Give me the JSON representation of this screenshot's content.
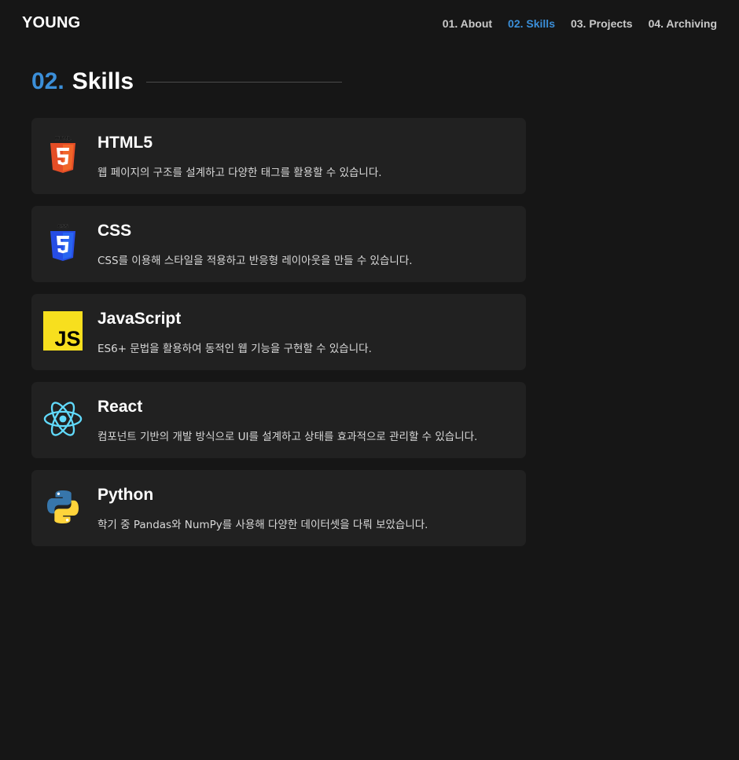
{
  "header": {
    "logo": "YOUNG",
    "nav": [
      {
        "label": "01. About",
        "active": false
      },
      {
        "label": "02. Skills",
        "active": true
      },
      {
        "label": "03. Projects",
        "active": false
      },
      {
        "label": "04. Archiving",
        "active": false
      }
    ]
  },
  "section": {
    "number": "02.",
    "title": "Skills"
  },
  "skills": [
    {
      "icon": "html5-icon",
      "name": "HTML5",
      "description": "웹 페이지의 구조를 설계하고 다양한 태그를 활용할 수 있습니다."
    },
    {
      "icon": "css3-icon",
      "name": "CSS",
      "description": "CSS를 이용해 스타일을 적용하고 반응형 레이아웃을 만들 수 있습니다."
    },
    {
      "icon": "javascript-icon",
      "name": "JavaScript",
      "description": "ES6+ 문법을 활용하여 동적인 웹 기능을 구현할 수 있습니다."
    },
    {
      "icon": "react-icon",
      "name": "React",
      "description": "컴포넌트 기반의 개발 방식으로 UI를 설계하고 상태를 효과적으로 관리할 수 있습니다."
    },
    {
      "icon": "python-icon",
      "name": "Python",
      "description": "학기 중 Pandas와 NumPy를 사용해 다양한 데이터셋을 다뤄 보았습니다."
    }
  ],
  "colors": {
    "background": "#161616",
    "card": "#212121",
    "accent": "#3b8fd9",
    "html5": "#e44d26",
    "css3": "#264de4",
    "javascript": "#f7df1e",
    "react": "#61dafb",
    "python_blue": "#3776ab",
    "python_yellow": "#ffd43b"
  }
}
